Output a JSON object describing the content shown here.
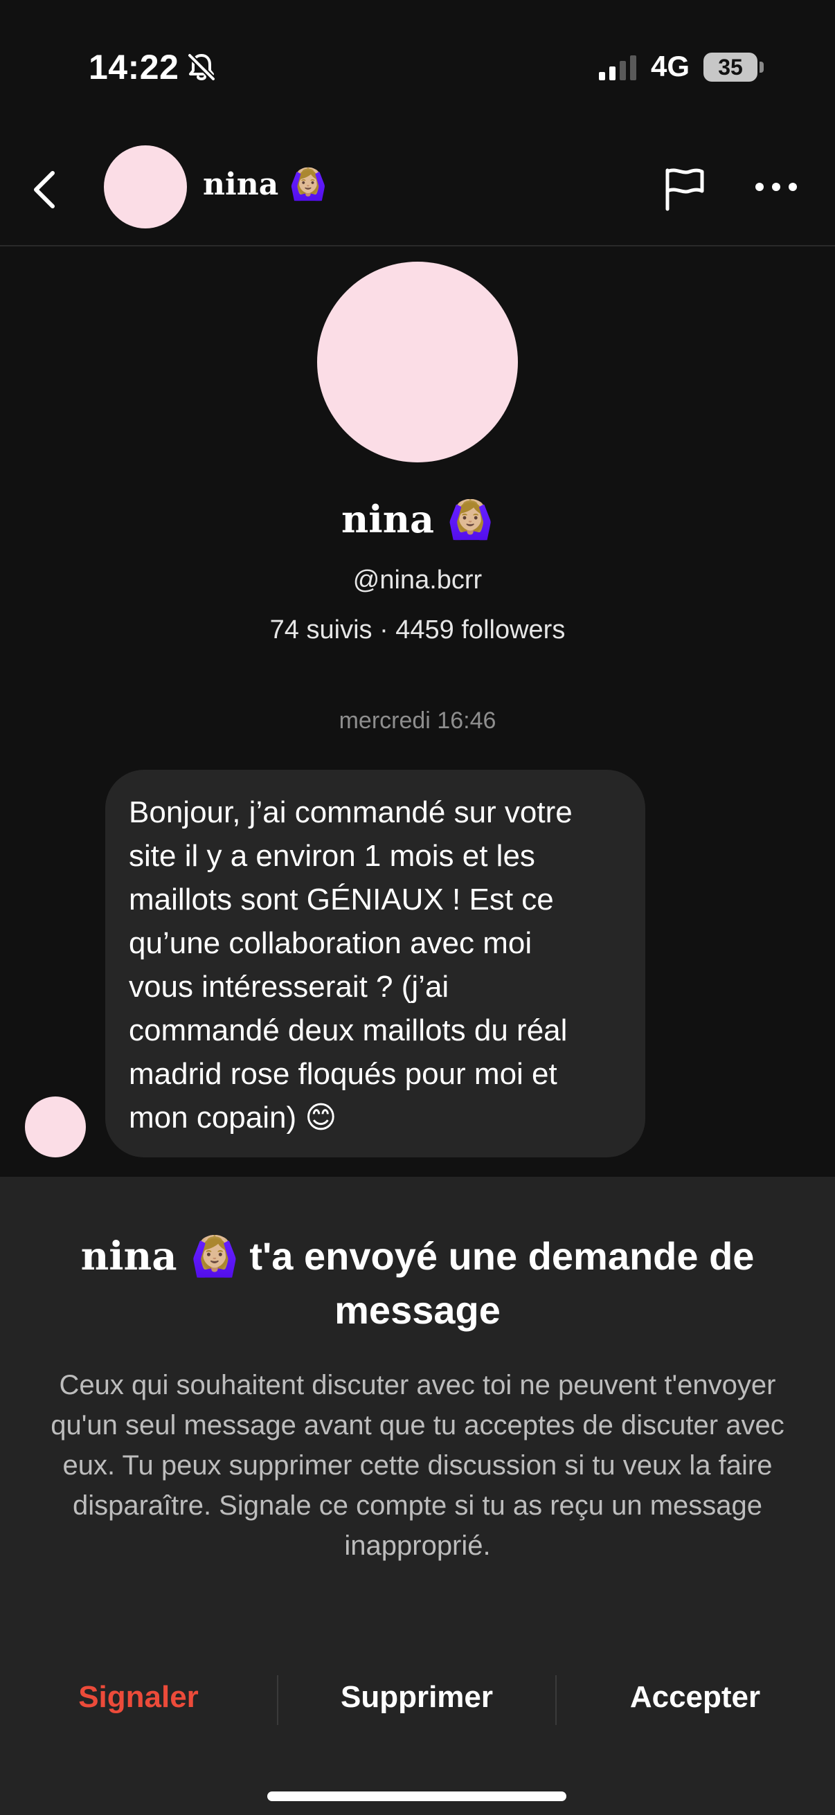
{
  "status_bar": {
    "time": "14:22",
    "network": "4G",
    "battery": "35"
  },
  "header": {
    "name": "nina 🙆🏼‍♀️"
  },
  "profile": {
    "name": "nina 🙆🏼‍♀️",
    "handle": "@nina.bcrr",
    "stats": "74 suivis · 4459 followers"
  },
  "conversation": {
    "timestamp": "mercredi 16:46",
    "message_lines": [
      "Bonjour, j’ai commandé sur votre",
      "site il y a environ 1 mois et les",
      "maillots sont GÉNIAUX ! Est ce",
      "qu’une collaboration avec moi",
      "vous intéresserait ? (j’ai",
      "commandé deux maillots du réal",
      "madrid rose floqués pour moi et",
      "mon copain) 😊"
    ]
  },
  "request": {
    "title_name": "nina 🙆🏼‍♀️",
    "title_text": " t'a envoyé une demande de message",
    "description": "Ceux qui souhaitent discuter avec toi ne peuvent t'envoyer qu'un seul message avant que tu acceptes de discuter avec eux. Tu peux supprimer cette discussion si tu veux la faire disparaître. Signale ce compte si tu as reçu un message inapproprié.",
    "actions": {
      "report": "Signaler",
      "delete": "Supprimer",
      "accept": "Accepter"
    }
  },
  "colors": {
    "background": "#111111",
    "sheet": "#242424",
    "bubble": "#262626",
    "avatar": "#fbdde6",
    "danger": "#ec4b3a",
    "muted": "#8e8e8e"
  },
  "icons": [
    "bell-slash-icon",
    "signal-icon",
    "back-chevron-icon",
    "flag-icon",
    "more-icon"
  ]
}
